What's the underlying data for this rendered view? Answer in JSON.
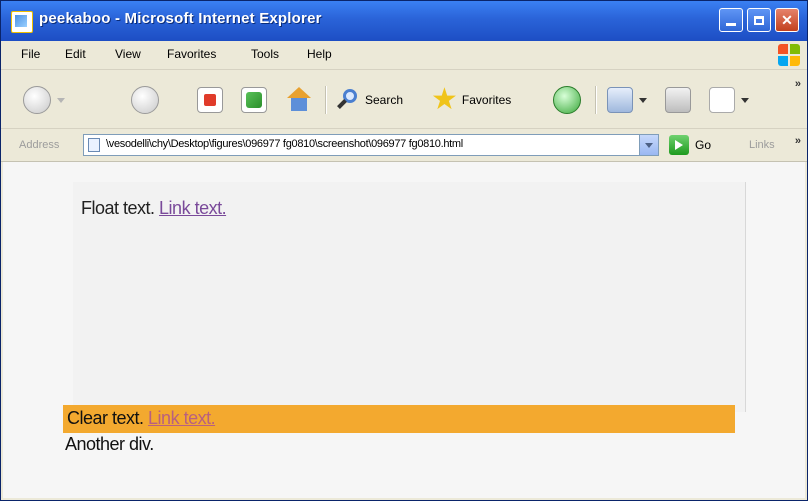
{
  "window": {
    "title": "peekaboo - Microsoft Internet Explorer"
  },
  "menubar": {
    "items": [
      "File",
      "Edit",
      "View",
      "Favorites",
      "Tools",
      "Help"
    ]
  },
  "toolbar": {
    "search_label": "Search",
    "favorites_label": "Favorites"
  },
  "addressbar": {
    "label": "Address",
    "url": "\\vesodelli\\chy\\Desktop\\figures\\096977 fg0810\\screenshot\\096977 fg0810.html",
    "go_label": "Go",
    "links_label": "Links"
  },
  "content": {
    "float_text": "Float text.",
    "float_link": "Link text.",
    "clear_text": "Clear text.",
    "clear_link": "Link text.",
    "another_div": "Another div."
  },
  "colors": {
    "title_bar": "#2a63d8",
    "clear_background": "#f3a92f",
    "link_visited": "#7a4a9a"
  },
  "icons": {
    "back": "back-arrow-icon",
    "forward": "forward-arrow-icon",
    "stop": "stop-icon",
    "refresh": "refresh-icon",
    "home": "home-icon",
    "search": "search-icon",
    "favorites": "favorites-star-icon",
    "history": "history-icon",
    "mail": "mail-icon",
    "print": "print-icon",
    "edit": "edit-icon"
  }
}
